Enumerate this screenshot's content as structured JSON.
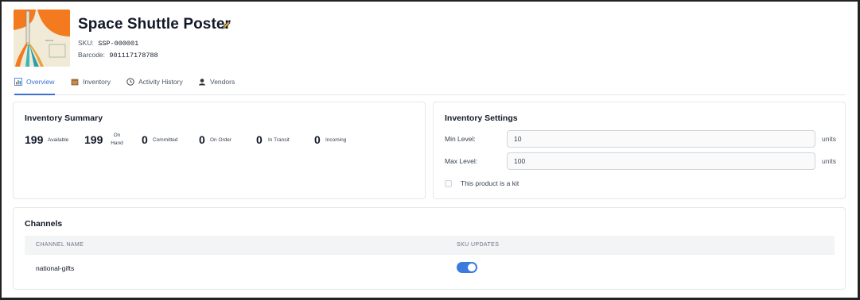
{
  "product": {
    "title": "Space Shuttle Poster",
    "sku_label": "SKU:",
    "sku": "SSP-000001",
    "barcode_label": "Barcode:",
    "barcode": "901117178788"
  },
  "tabs": [
    {
      "label": "Overview",
      "icon": "bar-chart-icon",
      "active": true
    },
    {
      "label": "Inventory",
      "icon": "box-icon",
      "active": false
    },
    {
      "label": "Activity History",
      "icon": "clock-icon",
      "active": false
    },
    {
      "label": "Vendors",
      "icon": "vendor-icon",
      "active": false
    }
  ],
  "summary": {
    "title": "Inventory Summary",
    "stats": [
      {
        "value": "199",
        "label": "Available"
      },
      {
        "value": "199",
        "label_line1": "On",
        "label_line2": "Hand"
      },
      {
        "value": "0",
        "label": "Committed"
      },
      {
        "value": "0",
        "label": "On Order"
      },
      {
        "value": "0",
        "label": "In Transit"
      },
      {
        "value": "0",
        "label": "Incoming"
      }
    ]
  },
  "settings": {
    "title": "Inventory Settings",
    "min_label": "Min Level:",
    "min_value": "10",
    "max_label": "Max Level:",
    "max_value": "100",
    "unit": "units",
    "kit_label": "This product is a kit",
    "kit_checked": false
  },
  "channels": {
    "title": "Channels",
    "columns": [
      "CHANNEL NAME",
      "SKU UPDATES"
    ],
    "rows": [
      {
        "name": "national-gifts",
        "sku_updates": true
      }
    ]
  },
  "colors": {
    "accent": "#3b6fd4",
    "toggle_on": "#3b7be0",
    "poster_orange": "#f47a20",
    "poster_bg": "#f1ead7"
  }
}
